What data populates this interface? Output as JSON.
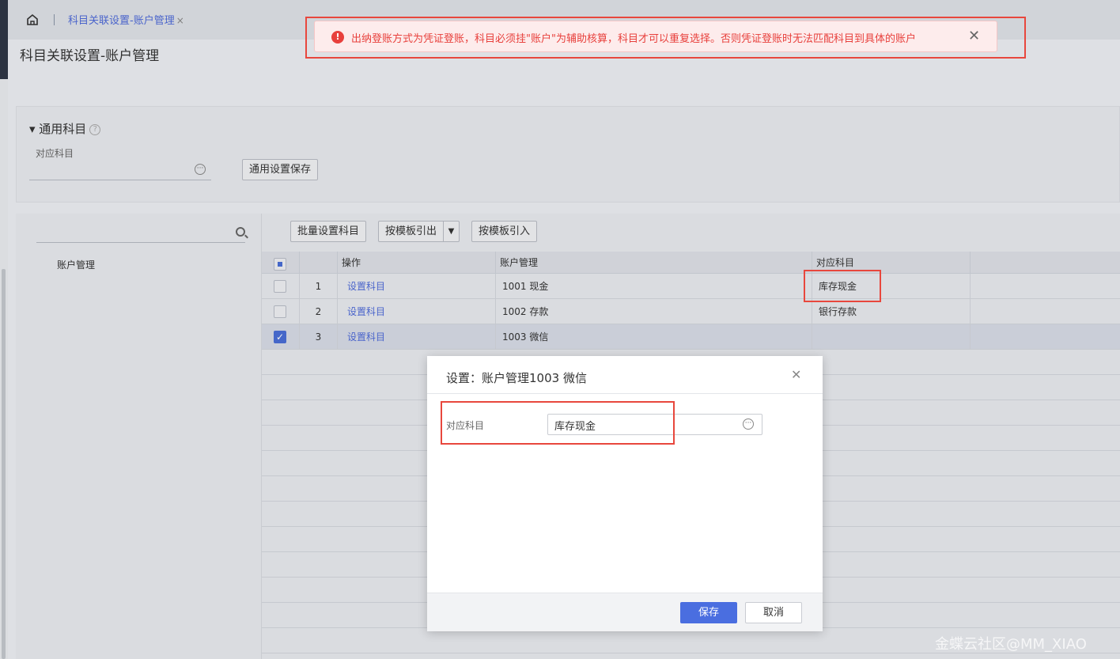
{
  "tabs": {
    "active_label": "科目关联设置-账户管理",
    "close_glyph": "×"
  },
  "page": {
    "title": "科目关联设置-账户管理"
  },
  "general": {
    "section_title": "▾ 通用科目",
    "help_glyph": "?",
    "field_label": "对应科目",
    "save_button": "通用设置保存",
    "ellipsis_glyph": "···"
  },
  "tree": {
    "item": "账户管理"
  },
  "toolbar": {
    "batch_set": "批量设置科目",
    "export_template": "按模板引出",
    "import_template": "按模板引入"
  },
  "grid": {
    "headers": {
      "op": "操作",
      "account": "账户管理",
      "subject": "对应科目"
    },
    "rows": [
      {
        "index": "1",
        "op": "设置科目",
        "account": "1001  现金",
        "subject": "库存现金"
      },
      {
        "index": "2",
        "op": "设置科目",
        "account": "1002  存款",
        "subject": "银行存款"
      },
      {
        "index": "3",
        "op": "设置科目",
        "account": "1003  微信",
        "subject": ""
      }
    ]
  },
  "toast": {
    "message": "出纳登账方式为凭证登账，科目必须挂\"账户\"为辅助核算，科目才可以重复选择。否则凭证登账时无法匹配科目到具体的账户"
  },
  "modal": {
    "title": "设置：账户管理1003 微信",
    "field_label": "对应科目",
    "field_value": "库存现金",
    "save": "保存",
    "cancel": "取消"
  },
  "watermark": "金蝶云社区@MM_XIAO",
  "colors": {
    "accent": "#4a6ee0",
    "error": "#e8403c",
    "annotation": "#e8473d"
  }
}
